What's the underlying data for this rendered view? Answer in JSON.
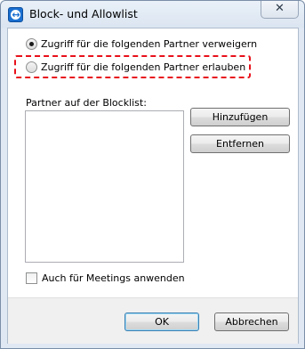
{
  "window": {
    "title": "Block- und Allowlist",
    "close_glyph": "✕",
    "app_icon": "teamviewer-icon"
  },
  "options": {
    "deny_label": "Zugriff für die folgenden Partner verweigern",
    "deny_selected": true,
    "allow_label": "Zugriff für die folgenden Partner erlauben",
    "allow_selected": false,
    "highlight_color": "#e8101a"
  },
  "blocklist": {
    "label": "Partner auf der Blocklist:",
    "items": [],
    "add_label": "Hinzufügen",
    "remove_label": "Entfernen"
  },
  "meetings": {
    "label": "Auch für Meetings anwenden",
    "checked": false
  },
  "footer": {
    "ok_label": "OK",
    "cancel_label": "Abbrechen"
  }
}
